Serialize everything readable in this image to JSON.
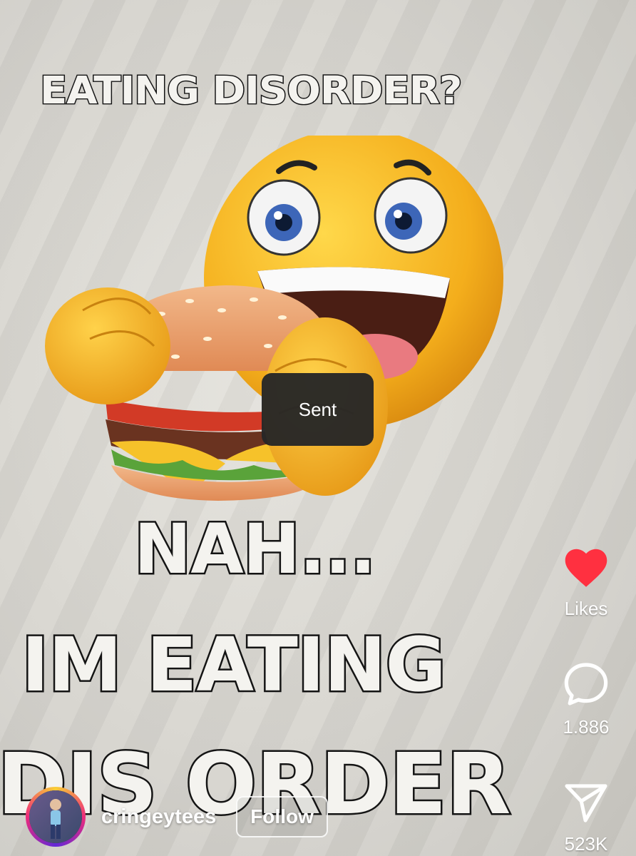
{
  "shirt_print": {
    "line1": "EATING DISORDER?",
    "line2": "NAH...",
    "line3": "IM EATING",
    "line4": "DIS ORDER"
  },
  "toast": {
    "label": "Sent"
  },
  "actions": {
    "likes_label": "Likes",
    "comments_count": "1.886",
    "shares_count": "523K",
    "like_color": "#ff3040"
  },
  "author": {
    "username": "cringeytees",
    "follow_label": "Follow"
  },
  "icons": {
    "like": "heart-icon",
    "comment": "comment-bubble-icon",
    "share": "paper-plane-icon"
  }
}
